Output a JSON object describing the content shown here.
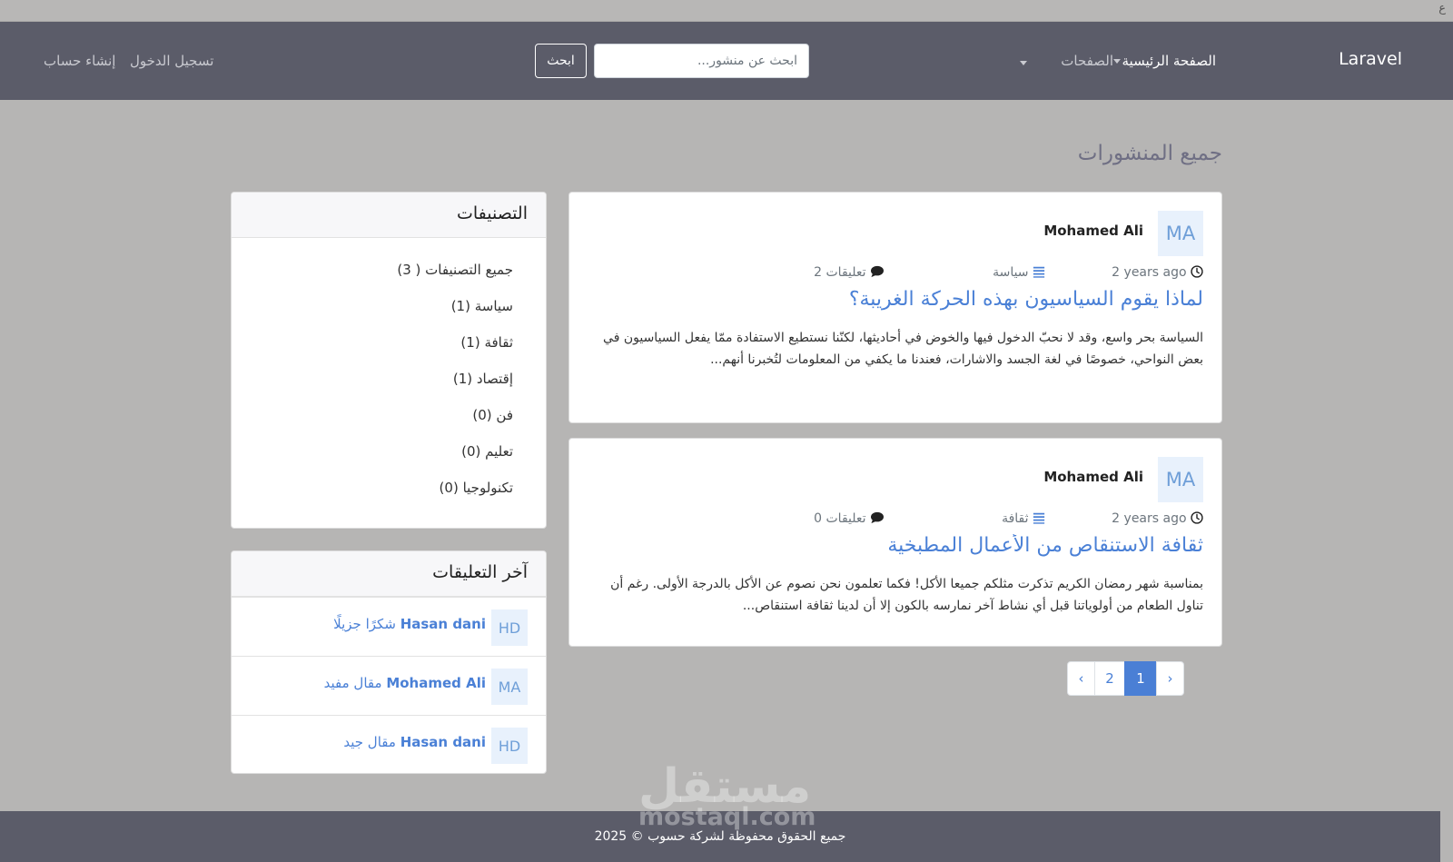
{
  "top_strip_glyph": "ع",
  "navbar": {
    "brand": "Laravel",
    "home": "الصفحة الرئيسية",
    "pages": "الصفحات",
    "search_placeholder": "ابحث عن منشور...",
    "search_button": "ابحث",
    "login": "تسجيل الدخول",
    "register": "إنشاء حساب"
  },
  "main": {
    "heading": "جميع المنشورات",
    "posts": [
      {
        "avatar": "MA",
        "author": "Mohamed Ali",
        "time": "2 years ago",
        "category": "سياسة",
        "comments": "2 تعليقات",
        "title": "لماذا يقوم السياسيون بهذه الحركة الغريبة؟",
        "excerpt": "السياسة بحر واسع، وقد لا نحبّ الدخول فيها والخوض في أحاديثها، لكنّنا نستطيع الاستفادة ممّا يفعل السياسيون في بعض النواحي، خصوصًا في لغة الجسد والاشارات، فعندنا ما يكفي من المعلومات لتُخبرنا أنهم..."
      },
      {
        "avatar": "MA",
        "author": "Mohamed Ali",
        "time": "2 years ago",
        "category": "ثقافة",
        "comments": "0 تعليقات",
        "title": "ثقافة الاستنقاص من الأعمال المطبخية",
        "excerpt": "بمناسبة شهر رمضان الكريم تذكرت مثلكم جميعا الأكل! فكما تعلمون نحن نصوم عن الأكل بالدرجة الأولى. رغم أن تناول الطعام من أولوياتنا قبل أي نشاط آخر نمارسه بالكون إلا أن لدينا ثقافة استنقاص..."
      }
    ],
    "pagination": {
      "prev": "‹",
      "pages": [
        "2",
        "1"
      ],
      "next": "›",
      "active": "1"
    }
  },
  "sidebar": {
    "categories_title": "التصنيفات",
    "categories": [
      "جميع التصنيفات ( 3)",
      "سياسة (1)",
      "ثقافة (1)",
      "إقتصاد (1)",
      "فن (0)",
      "تعليم (0)",
      "تكنولوجيا (0)"
    ],
    "comments_title": "آخر التعليقات",
    "comments": [
      {
        "avatar": "HD",
        "user": "Hasan dani",
        "text": "شكرًا جزيلًا"
      },
      {
        "avatar": "MA",
        "user": "Mohamed Ali",
        "text": "مقال مفيد"
      },
      {
        "avatar": "HD",
        "user": "Hasan dani",
        "text": "مقال جيد"
      }
    ]
  },
  "footer": {
    "text": "جميع الحقوق محفوظة لشركة حسوب © 2025"
  },
  "watermark": {
    "arabic": "مستقل",
    "latin": "mostaql.com"
  },
  "colors": {
    "navbar": "#5b5c69",
    "page_background": "#b6b5b4",
    "link": "#4a80d6",
    "avatar_bg": "#e8f1fc",
    "active_page": "#4a7fd5"
  },
  "icons": {
    "time": "clock-icon",
    "category": "list-icon",
    "comments": "comment-icon"
  }
}
